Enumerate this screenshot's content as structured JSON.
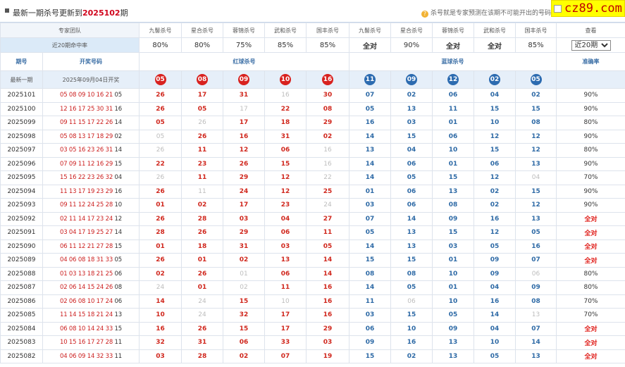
{
  "header": {
    "title_prefix": "最新一期杀号更新到",
    "title_period": "2025102",
    "title_suffix": "期",
    "notice": "杀号就是专家预测在该期不可能开出的号码"
  },
  "watermark": "cz89.com",
  "columns": {
    "expert_team": "专家团队",
    "experts": [
      "九髻杀号",
      "星合杀号",
      "蓉锦杀号",
      "武和杀号",
      "国丰杀号",
      "九髻杀号",
      "星合杀号",
      "蓉锦杀号",
      "武和杀号",
      "国丰杀号"
    ],
    "votes": "查看"
  },
  "hit_rate": {
    "label": "近20期命中率",
    "values": [
      "80%",
      "80%",
      "75%",
      "85%",
      "85%",
      "全对",
      "90%",
      "全对",
      "全对",
      "85%"
    ],
    "select_value": "近20期"
  },
  "section": {
    "period": "期号",
    "draw": "开奖号码",
    "red": "红球杀号",
    "blue": "蓝球杀号",
    "accuracy": "准确率"
  },
  "latest": {
    "label": "最新一期",
    "date": "2025年09月04日开奖",
    "red_kills": [
      "05",
      "08",
      "09",
      "10",
      "16"
    ],
    "blue_kills": [
      "11",
      "09",
      "12",
      "02",
      "05"
    ]
  },
  "rows": [
    {
      "period": "2025101",
      "reds": "05 08 09 10 16 21",
      "blue": "05",
      "kills": [
        "26",
        "17",
        "31",
        "16",
        "30",
        "07",
        "02",
        "06",
        "04",
        "02"
      ],
      "miss": [
        3
      ],
      "acc": "90%"
    },
    {
      "period": "2025100",
      "reds": "12 16 17 25 30 31",
      "blue": "16",
      "kills": [
        "26",
        "05",
        "17",
        "22",
        "08",
        "05",
        "13",
        "11",
        "15",
        "15"
      ],
      "miss": [
        2
      ],
      "acc": "90%"
    },
    {
      "period": "2025099",
      "reds": "09 11 15 17 22 26",
      "blue": "14",
      "kills": [
        "05",
        "26",
        "17",
        "18",
        "29",
        "16",
        "03",
        "01",
        "10",
        "08"
      ],
      "miss": [
        1
      ],
      "acc": "80%"
    },
    {
      "period": "2025098",
      "reds": "05 08 13 17 18 29",
      "blue": "02",
      "kills": [
        "05",
        "26",
        "16",
        "31",
        "02",
        "14",
        "15",
        "06",
        "12",
        "12"
      ],
      "miss": [
        0
      ],
      "acc": "90%"
    },
    {
      "period": "2025097",
      "reds": "03 05 16 23 26 31",
      "blue": "14",
      "kills": [
        "26",
        "11",
        "12",
        "06",
        "16",
        "13",
        "04",
        "10",
        "15",
        "12"
      ],
      "miss": [
        0,
        4
      ],
      "acc": "80%"
    },
    {
      "period": "2025096",
      "reds": "07 09 11 12 16 29",
      "blue": "15",
      "kills": [
        "22",
        "23",
        "26",
        "15",
        "16",
        "14",
        "06",
        "01",
        "06",
        "13"
      ],
      "miss": [
        4
      ],
      "acc": "90%"
    },
    {
      "period": "2025095",
      "reds": "15 16 22 23 26 32",
      "blue": "04",
      "kills": [
        "26",
        "11",
        "29",
        "12",
        "22",
        "14",
        "05",
        "15",
        "12",
        "04"
      ],
      "miss": [
        0,
        4,
        9
      ],
      "acc": "70%"
    },
    {
      "period": "2025094",
      "reds": "11 13 17 19 23 29",
      "blue": "16",
      "kills": [
        "26",
        "11",
        "24",
        "12",
        "25",
        "01",
        "06",
        "13",
        "02",
        "15"
      ],
      "miss": [
        1
      ],
      "acc": "90%"
    },
    {
      "period": "2025093",
      "reds": "09 11 12 24 25 28",
      "blue": "10",
      "kills": [
        "01",
        "02",
        "17",
        "23",
        "24",
        "03",
        "06",
        "08",
        "02",
        "12"
      ],
      "miss": [
        4
      ],
      "acc": "90%"
    },
    {
      "period": "2025092",
      "reds": "02 11 14 17 23 24",
      "blue": "12",
      "kills": [
        "26",
        "28",
        "03",
        "04",
        "27",
        "07",
        "14",
        "09",
        "16",
        "13"
      ],
      "miss": [],
      "acc": "全对"
    },
    {
      "period": "2025091",
      "reds": "03 04 17 19 25 27",
      "blue": "14",
      "kills": [
        "28",
        "26",
        "29",
        "06",
        "11",
        "05",
        "13",
        "15",
        "12",
        "05"
      ],
      "miss": [],
      "acc": "全对"
    },
    {
      "period": "2025090",
      "reds": "06 11 12 21 27 28",
      "blue": "15",
      "kills": [
        "01",
        "18",
        "31",
        "03",
        "05",
        "14",
        "13",
        "03",
        "05",
        "16"
      ],
      "miss": [],
      "acc": "全对"
    },
    {
      "period": "2025089",
      "reds": "04 06 08 18 31 33",
      "blue": "05",
      "kills": [
        "26",
        "01",
        "02",
        "13",
        "14",
        "15",
        "15",
        "01",
        "09",
        "07"
      ],
      "miss": [],
      "acc": "全对"
    },
    {
      "period": "2025088",
      "reds": "01 03 13 18 21 25",
      "blue": "06",
      "kills": [
        "02",
        "26",
        "01",
        "06",
        "14",
        "08",
        "08",
        "10",
        "09",
        "06"
      ],
      "miss": [
        2,
        9
      ],
      "acc": "80%"
    },
    {
      "period": "2025087",
      "reds": "02 06 14 15 24 26",
      "blue": "08",
      "kills": [
        "24",
        "01",
        "02",
        "11",
        "16",
        "14",
        "05",
        "01",
        "04",
        "09"
      ],
      "miss": [
        0,
        2
      ],
      "acc": "80%"
    },
    {
      "period": "2025086",
      "reds": "02 06 08 10 17 24",
      "blue": "06",
      "kills": [
        "14",
        "24",
        "15",
        "10",
        "16",
        "11",
        "06",
        "10",
        "16",
        "08"
      ],
      "miss": [
        1,
        3,
        6
      ],
      "acc": "70%"
    },
    {
      "period": "2025085",
      "reds": "11 14 15 18 21 24",
      "blue": "13",
      "kills": [
        "10",
        "24",
        "32",
        "17",
        "16",
        "03",
        "15",
        "05",
        "14",
        "13"
      ],
      "miss": [
        1,
        9
      ],
      "acc": "70%"
    },
    {
      "period": "2025084",
      "reds": "06 08 10 14 24 33",
      "blue": "15",
      "kills": [
        "16",
        "26",
        "15",
        "17",
        "29",
        "06",
        "10",
        "09",
        "04",
        "07"
      ],
      "miss": [],
      "acc": "全对"
    },
    {
      "period": "2025083",
      "reds": "10 15 16 17 27 28",
      "blue": "11",
      "kills": [
        "32",
        "31",
        "06",
        "33",
        "03",
        "09",
        "16",
        "13",
        "10",
        "14"
      ],
      "miss": [],
      "acc": "全对"
    },
    {
      "period": "2025082",
      "reds": "04 06 09 14 32 33",
      "blue": "11",
      "kills": [
        "03",
        "28",
        "02",
        "07",
        "19",
        "15",
        "02",
        "13",
        "05",
        "13"
      ],
      "miss": [],
      "acc": "全对"
    }
  ]
}
